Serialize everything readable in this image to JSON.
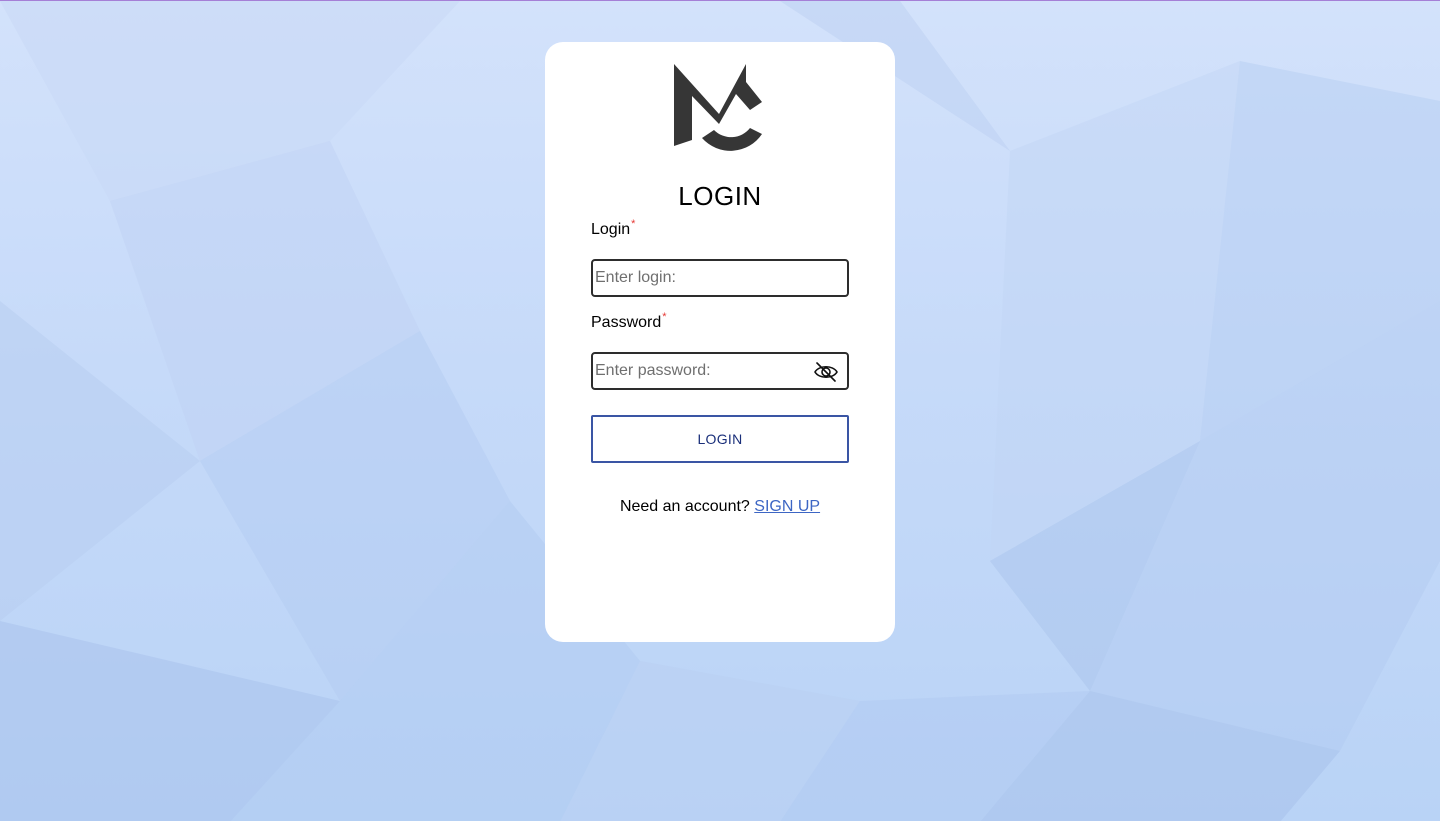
{
  "colors": {
    "accent": "#3a55a4",
    "link": "#3d66c4",
    "required": "#e53935",
    "card": "#ffffff"
  },
  "logo": {
    "icon": "mc-logo-icon"
  },
  "form": {
    "title": "LOGIN",
    "login_label": "Login",
    "login_placeholder": "Enter login:",
    "password_label": "Password",
    "password_placeholder": "Enter password:",
    "required_mark": "*",
    "toggle_visibility_icon": "eye-slash-icon",
    "submit_label": "LOGIN"
  },
  "footer": {
    "prompt": "Need an account?",
    "signup_link": "SIGN UP"
  }
}
